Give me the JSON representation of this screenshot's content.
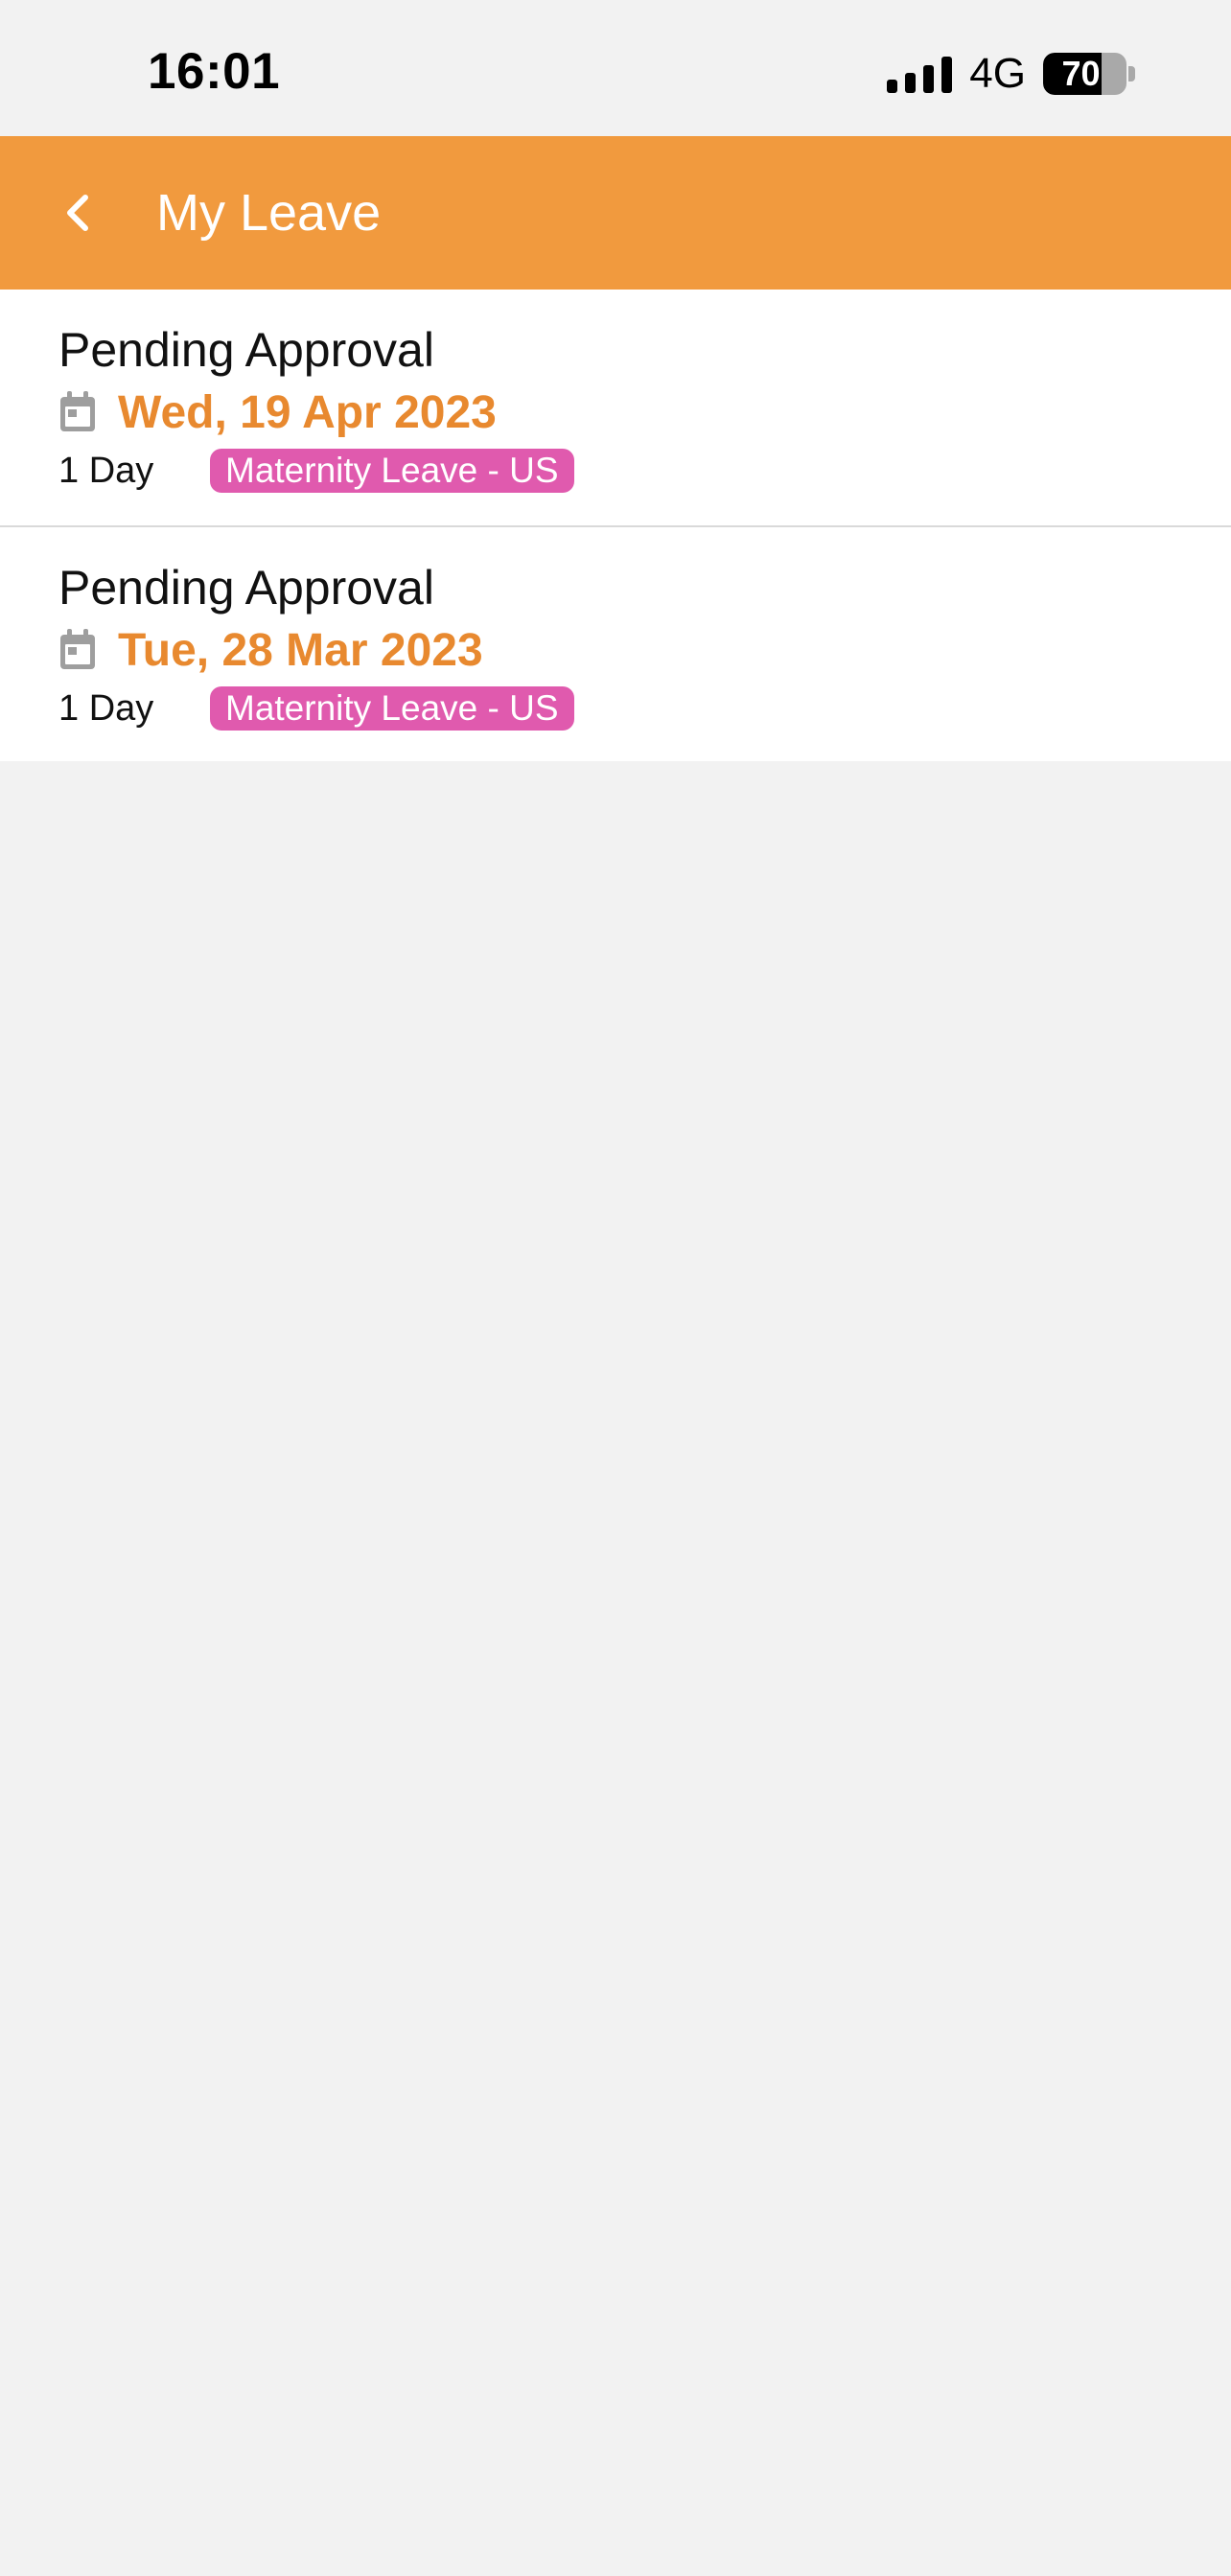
{
  "status_bar": {
    "time": "16:01",
    "network": "4G",
    "battery_level": 70,
    "battery_label": "70"
  },
  "header": {
    "title": "My Leave",
    "back_icon": "chevron-left-icon",
    "background_color": "#f19a3e",
    "text_color": "#ffffff"
  },
  "colors": {
    "accent_date": "#e8892f",
    "badge_background": "#e05aae",
    "calendar_icon": "#9e9e9e",
    "divider": "#d9d9d9",
    "page_background": "#f2f2f2"
  },
  "leave_items": [
    {
      "status": "Pending Approval",
      "date": "Wed, 19 Apr 2023",
      "duration": "1 Day",
      "type": "Maternity Leave - US"
    },
    {
      "status": "Pending Approval",
      "date": "Tue, 28 Mar 2023",
      "duration": "1 Day",
      "type": "Maternity Leave - US"
    }
  ]
}
